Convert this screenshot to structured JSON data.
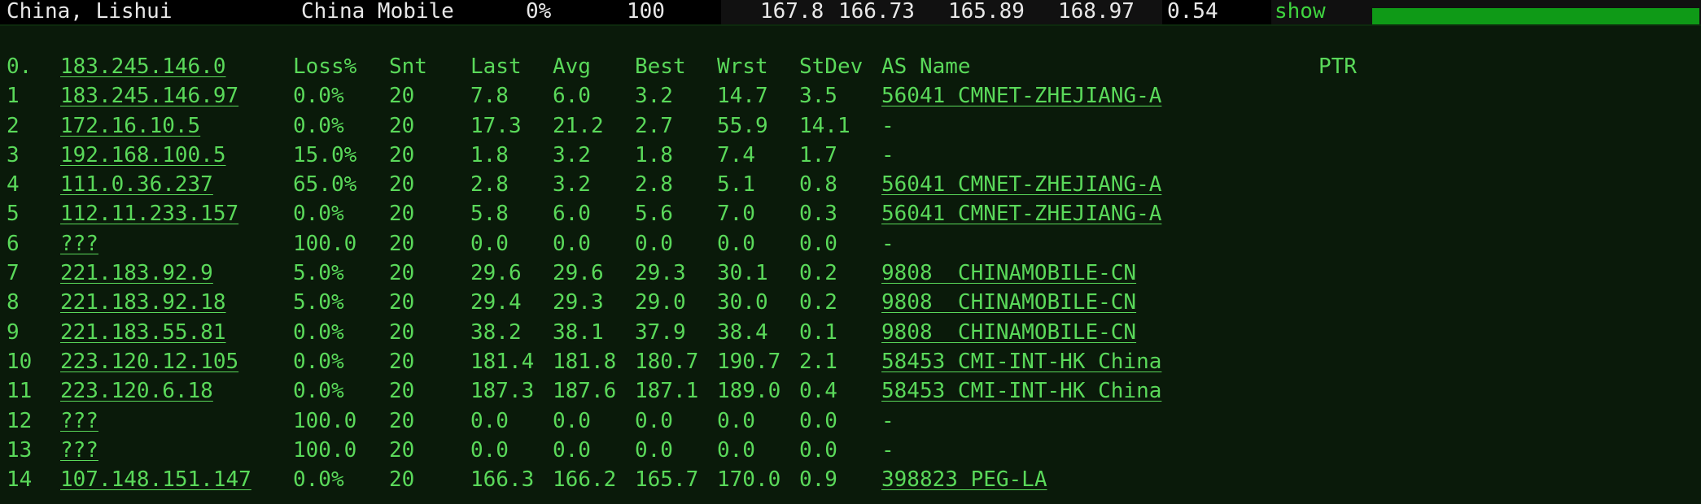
{
  "summary": {
    "location": "China, Lishui",
    "isp": "China Mobile",
    "loss": "0%",
    "sent": "100",
    "last": "167.8",
    "avg": "166.73",
    "best": "165.89",
    "worst": "168.97",
    "stdev": "0.54",
    "show_label": "show",
    "bar_fraction": 1.0,
    "bar_color": "#0f9a17"
  },
  "table": {
    "headers": {
      "index": "0.",
      "host": "183.245.146.0",
      "loss": "Loss%",
      "snt": "Snt",
      "last": "Last",
      "avg": "Avg",
      "best": "Best",
      "wrst": "Wrst",
      "stdev": "StDev",
      "as_name": "AS Name",
      "ptr": "PTR"
    },
    "rows": [
      {
        "idx": "1",
        "host": "183.245.146.97",
        "loss": "0.0%",
        "snt": "20",
        "last": "7.8",
        "avg": "6.0",
        "best": "3.2",
        "wrst": "14.7",
        "stdev": "3.5",
        "as": "56041 CMNET-ZHEJIANG-A"
      },
      {
        "idx": "2",
        "host": "172.16.10.5",
        "loss": "0.0%",
        "snt": "20",
        "last": "17.3",
        "avg": "21.2",
        "best": "2.7",
        "wrst": "55.9",
        "stdev": "14.1",
        "as": "-"
      },
      {
        "idx": "3",
        "host": "192.168.100.5",
        "loss": "15.0%",
        "snt": "20",
        "last": "1.8",
        "avg": "3.2",
        "best": "1.8",
        "wrst": "7.4",
        "stdev": "1.7",
        "as": "-"
      },
      {
        "idx": "4",
        "host": "111.0.36.237",
        "loss": "65.0%",
        "snt": "20",
        "last": "2.8",
        "avg": "3.2",
        "best": "2.8",
        "wrst": "5.1",
        "stdev": "0.8",
        "as": "56041 CMNET-ZHEJIANG-A"
      },
      {
        "idx": "5",
        "host": "112.11.233.157",
        "loss": "0.0%",
        "snt": "20",
        "last": "5.8",
        "avg": "6.0",
        "best": "5.6",
        "wrst": "7.0",
        "stdev": "0.3",
        "as": "56041 CMNET-ZHEJIANG-A"
      },
      {
        "idx": "6",
        "host": "???",
        "loss": "100.0",
        "snt": "20",
        "last": "0.0",
        "avg": "0.0",
        "best": "0.0",
        "wrst": "0.0",
        "stdev": "0.0",
        "as": "-"
      },
      {
        "idx": "7",
        "host": "221.183.92.9",
        "loss": "5.0%",
        "snt": "20",
        "last": "29.6",
        "avg": "29.6",
        "best": "29.3",
        "wrst": "30.1",
        "stdev": "0.2",
        "as": "9808  CHINAMOBILE-CN"
      },
      {
        "idx": "8",
        "host": "221.183.92.18",
        "loss": "5.0%",
        "snt": "20",
        "last": "29.4",
        "avg": "29.3",
        "best": "29.0",
        "wrst": "30.0",
        "stdev": "0.2",
        "as": "9808  CHINAMOBILE-CN"
      },
      {
        "idx": "9",
        "host": "221.183.55.81",
        "loss": "0.0%",
        "snt": "20",
        "last": "38.2",
        "avg": "38.1",
        "best": "37.9",
        "wrst": "38.4",
        "stdev": "0.1",
        "as": "9808  CHINAMOBILE-CN"
      },
      {
        "idx": "10",
        "host": "223.120.12.105",
        "loss": "0.0%",
        "snt": "20",
        "last": "181.4",
        "avg": "181.8",
        "best": "180.7",
        "wrst": "190.7",
        "stdev": "2.1",
        "as": "58453 CMI-INT-HK China"
      },
      {
        "idx": "11",
        "host": "223.120.6.18",
        "loss": "0.0%",
        "snt": "20",
        "last": "187.3",
        "avg": "187.6",
        "best": "187.1",
        "wrst": "189.0",
        "stdev": "0.4",
        "as": "58453 CMI-INT-HK China"
      },
      {
        "idx": "12",
        "host": "???",
        "loss": "100.0",
        "snt": "20",
        "last": "0.0",
        "avg": "0.0",
        "best": "0.0",
        "wrst": "0.0",
        "stdev": "0.0",
        "as": "-"
      },
      {
        "idx": "13",
        "host": "???",
        "loss": "100.0",
        "snt": "20",
        "last": "0.0",
        "avg": "0.0",
        "best": "0.0",
        "wrst": "0.0",
        "stdev": "0.0",
        "as": "-"
      },
      {
        "idx": "14",
        "host": "107.148.151.147",
        "loss": "0.0%",
        "snt": "20",
        "last": "166.3",
        "avg": "166.2",
        "best": "165.7",
        "wrst": "170.0",
        "stdev": "0.9",
        "as": "398823 PEG-LA"
      }
    ]
  }
}
